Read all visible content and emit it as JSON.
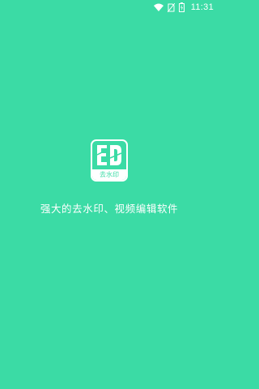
{
  "status_bar": {
    "time": "11:31",
    "icons": [
      "wifi-icon",
      "no-sim-icon",
      "battery-charging-icon"
    ]
  },
  "splash": {
    "logo_text": "ED",
    "logo_caption": "去水印",
    "tagline": "强大的去水印、视频编辑软件"
  },
  "colors": {
    "background": "#3bdba5",
    "foreground": "#ffffff"
  }
}
